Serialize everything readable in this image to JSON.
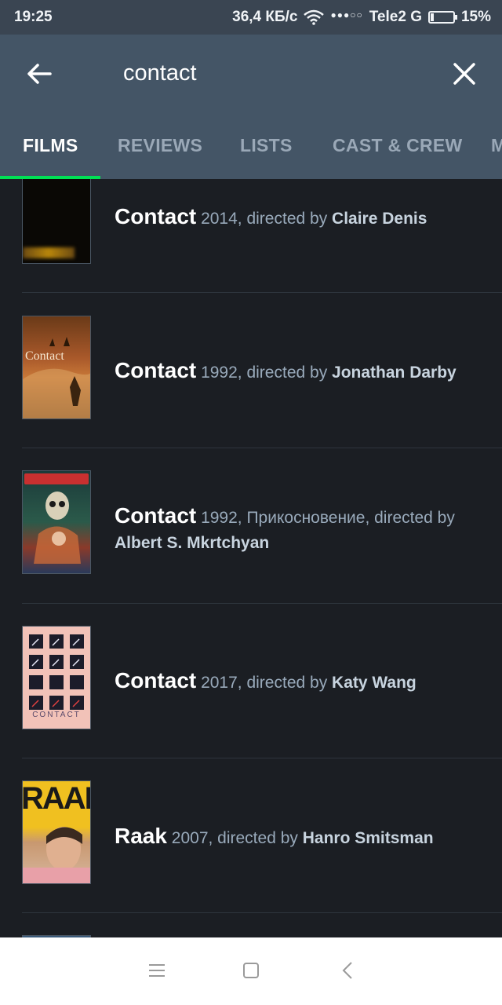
{
  "status_bar": {
    "time": "19:25",
    "network_speed": "36,4 КБ/с",
    "carrier": "Tele2 G",
    "battery": "15%",
    "battery_level": 0.15
  },
  "search": {
    "query": "contact"
  },
  "tabs": [
    {
      "label": "FILMS",
      "active": true
    },
    {
      "label": "REVIEWS",
      "active": false
    },
    {
      "label": "LISTS",
      "active": false
    },
    {
      "label": "CAST & CREW",
      "active": false
    },
    {
      "label": "M",
      "active": false
    }
  ],
  "colors": {
    "accent": "#00e054",
    "app_bar": "#445566",
    "background": "#1b1e23"
  },
  "results": [
    {
      "title": "Contact",
      "year_text": "2014, directed by",
      "director": "Claire Denis",
      "poster_text": ""
    },
    {
      "title": "Contact",
      "year_text": "1992, directed by",
      "director": "Jonathan Darby",
      "poster_text": "Contact"
    },
    {
      "title": "Contact",
      "year_text": "1992, Прикосновение, directed by",
      "director": "Albert S. Mkrtchyan",
      "poster_text": ""
    },
    {
      "title": "Contact",
      "year_text": "2017, directed by",
      "director": "Katy Wang",
      "poster_text": "CONTACT"
    },
    {
      "title": "Raak",
      "year_text": "2007, directed by",
      "director": "Hanro Smitsman",
      "poster_text": "RAAK"
    }
  ],
  "icons": {
    "back": "arrow-left-icon",
    "close": "close-icon",
    "nav_menu": "menu-icon",
    "nav_home": "square-home-icon",
    "nav_back": "chevron-left-icon"
  }
}
